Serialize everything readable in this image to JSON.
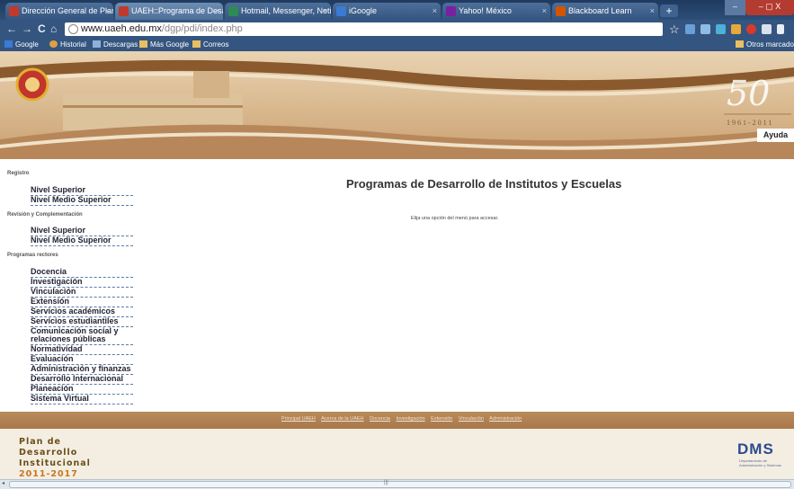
{
  "browser": {
    "tabs": [
      {
        "label": "Dirección General de Planea",
        "color": "#c0392b"
      },
      {
        "label": "UAEH::Programa de Desarr",
        "color": "#c0392b"
      },
      {
        "label": "Hotmail, Messenger, Notic",
        "color": "#2e8b57"
      },
      {
        "label": "iGoogle",
        "color": "#3a7bd5"
      },
      {
        "label": "Yahoo! México",
        "color": "#7b1fa2"
      },
      {
        "label": "Blackboard Learn",
        "color": "#d35400"
      }
    ],
    "new_tab": "+",
    "window_controls": "– ▢ X",
    "url_host": "www.uaeh.edu.mx",
    "url_path": "/dgp/pdi/index.php",
    "nav": {
      "back": "←",
      "forward": "→",
      "reload": "C",
      "home": "⌂"
    },
    "star": "☆",
    "bookmarks": [
      {
        "label": "Google",
        "icon": "google-icon"
      },
      {
        "label": "Historial",
        "icon": "history-icon"
      },
      {
        "label": "Descargas",
        "icon": "download-icon"
      },
      {
        "label": "Más Google",
        "icon": "folder-icon"
      },
      {
        "label": "Correos",
        "icon": "folder-icon"
      }
    ],
    "other_bookmarks": "Otros marcadores"
  },
  "banner": {
    "years": "1961-2011",
    "anniversary": "50",
    "ayuda": "Ayuda"
  },
  "sidebar": {
    "sections": [
      {
        "title": "Registro",
        "links": [
          "Nivel Superior",
          "Nivel Medio Superior"
        ]
      },
      {
        "title": "Revisión y Complementación",
        "links": [
          "Nivel Superior",
          "Nivel Medio Superior"
        ]
      },
      {
        "title": "Programas rectores",
        "links": [
          "Docencia",
          "Investigación",
          "Vinculación",
          "Extensión",
          "Servicios académicos",
          "Servicios estudiantiles",
          "Comunicación social y relaciones públicas",
          "Normatividad",
          "Evaluación",
          "Administración y finanzas",
          "Desarrollo Internacional",
          "Planeación",
          "Sistema Virtual"
        ]
      }
    ]
  },
  "main": {
    "title": "Programas de Desarrollo de Institutos y Escuelas",
    "subtitle": "Elija una opción del menú para accesar."
  },
  "footer": {
    "links": [
      "Principal UAEH",
      "Acerca de la UAEH",
      "Docencia",
      "Investigación",
      "Extensión",
      "Vinculación",
      "Administración"
    ],
    "plan_lines": [
      "Plan de",
      "Desarrollo",
      "Institucional"
    ],
    "plan_years": "2011-2017",
    "dms_logo": "DMS",
    "dms_sub": "Departamento de Administración y Sistemas"
  }
}
